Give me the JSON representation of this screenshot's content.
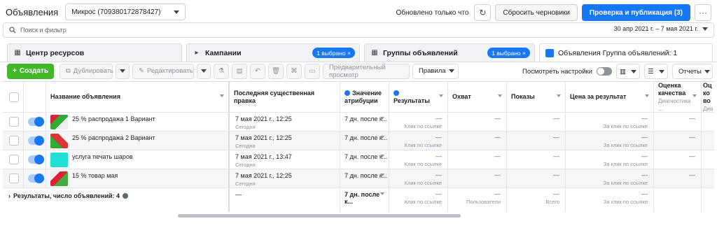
{
  "header": {
    "title": "Объявления",
    "account": "Микрос (709380172878427)",
    "updated_text": "Обновлено только что",
    "discard_label": "Сбросить черновики",
    "publish_label": "Проверка и публикация (3)",
    "more_label": "···"
  },
  "search": {
    "placeholder": "Поиск и фильтр",
    "date_range": "30 апр 2021 г. – 7 мая 2021 г."
  },
  "tabs": [
    {
      "label": "Центр ресурсов"
    },
    {
      "label": "Кампании",
      "chip": "1 выбрано ×"
    },
    {
      "label": "Группы объявлений",
      "chip": "1 выбрано ×"
    },
    {
      "label": "Объявления Группа объявлений: 1"
    }
  ],
  "toolbar": {
    "create_label": "Создать",
    "duplicate_label": "Дублировать",
    "edit_label": "Редактировать",
    "preview_label": "Предварительный просмотр",
    "rules_label": "Правила",
    "view_settings_label": "Посмотреть настройки",
    "reports_label": "Отчеты"
  },
  "table": {
    "columns": {
      "name": "Название объявления",
      "last_edit": "Последняя существенная правка",
      "attribution": "Значение атрибуции",
      "results": "Результаты",
      "reach": "Охват",
      "impressions": "Показы",
      "cost_per_result": "Цена за результат",
      "quality": "Оценка качества",
      "quality_sub": "Диагностика ...",
      "extra": "Оц ко во",
      "extra_sub": "Диа"
    },
    "rows": [
      {
        "name": "25 % распродажа 1 Вариант",
        "edit": "7 мая 2021 г., 12:25",
        "edit_sub": "Сегодня",
        "attribution": "7 дн. после к...",
        "results": "—",
        "results_sub": "Клик по ссылке",
        "reach": "—",
        "impressions": "—",
        "cost": "—",
        "cost_sub": "За клик по ссылке",
        "quality": "—"
      },
      {
        "name": "25 % распродажа 2 Вариант",
        "edit": "7 мая 2021 г., 12:25",
        "edit_sub": "Сегодня",
        "attribution": "7 дн. после к...",
        "results": "—",
        "results_sub": "Клик по ссылке",
        "reach": "—",
        "impressions": "—",
        "cost": "—",
        "cost_sub": "За клик по ссылке",
        "quality": "—"
      },
      {
        "name": "услуга печать шаров",
        "edit": "7 мая 2021 г., 13:47",
        "edit_sub": "Сегодня",
        "attribution": "7 дн. после к...",
        "results": "—",
        "results_sub": "Клик по ссылке",
        "reach": "—",
        "impressions": "—",
        "cost": "—",
        "cost_sub": "За клик по ссылке",
        "quality": "—"
      },
      {
        "name": "15 % товар мая",
        "edit": "7 мая 2021 г., 12:25",
        "edit_sub": "Сегодня",
        "attribution": "7 дн. после к...",
        "results": "—",
        "results_sub": "Клик по ссылке",
        "reach": "—",
        "impressions": "—",
        "cost": "—",
        "cost_sub": "За клик по ссылке",
        "quality": "—"
      }
    ],
    "summary": {
      "label": "Результаты, число объявлений: 4",
      "edit": "—",
      "attribution": "7 дн. после к...",
      "results": "—",
      "results_sub": "Клик по ссылке",
      "reach": "—",
      "reach_sub": "Пользователи",
      "impressions": "—",
      "impressions_sub": "Всего",
      "cost": "—",
      "cost_sub": "За клик по ссылке"
    }
  }
}
